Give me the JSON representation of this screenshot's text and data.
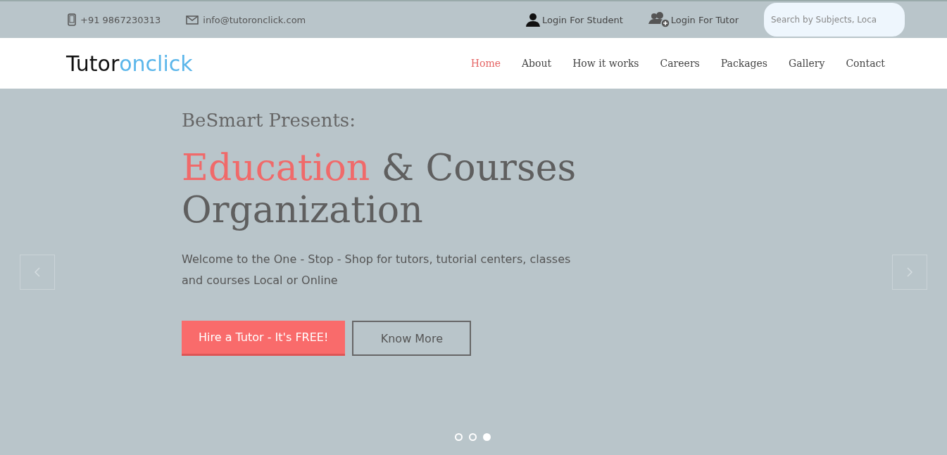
{
  "top_bar": {
    "phone": "+91 9867230313",
    "email": "info@tutoronclick.com",
    "logins": [
      {
        "label": "Login For Student",
        "kind": "student"
      },
      {
        "label": "Login For Tutor",
        "kind": "tutor"
      }
    ],
    "search": {
      "placeholder": "Search by Subjects, Loca"
    }
  },
  "logo": {
    "dark": "Tutor",
    "accent": "onclick"
  },
  "nav": [
    {
      "label": "Home",
      "selected": true
    },
    {
      "label": "About",
      "selected": false
    },
    {
      "label": "How it works",
      "selected": false
    },
    {
      "label": "Careers",
      "selected": false
    },
    {
      "label": "Packages",
      "selected": false
    },
    {
      "label": "Gallery",
      "selected": false
    },
    {
      "label": "Contact",
      "selected": false
    }
  ],
  "hero": {
    "kicker": "BeSmart Presents:",
    "headline_accent": "Education",
    "headline_rest": "& Courses Organization",
    "text": "Welcome to the One - Stop - Shop for tutors, tutorial centers, classes and courses Local or Online",
    "primary_button": "Hire a Tutor - It's FREE!",
    "secondary_button": "Know More",
    "dots": [
      {
        "selected": false
      },
      {
        "selected": false
      },
      {
        "selected": true
      }
    ]
  }
}
